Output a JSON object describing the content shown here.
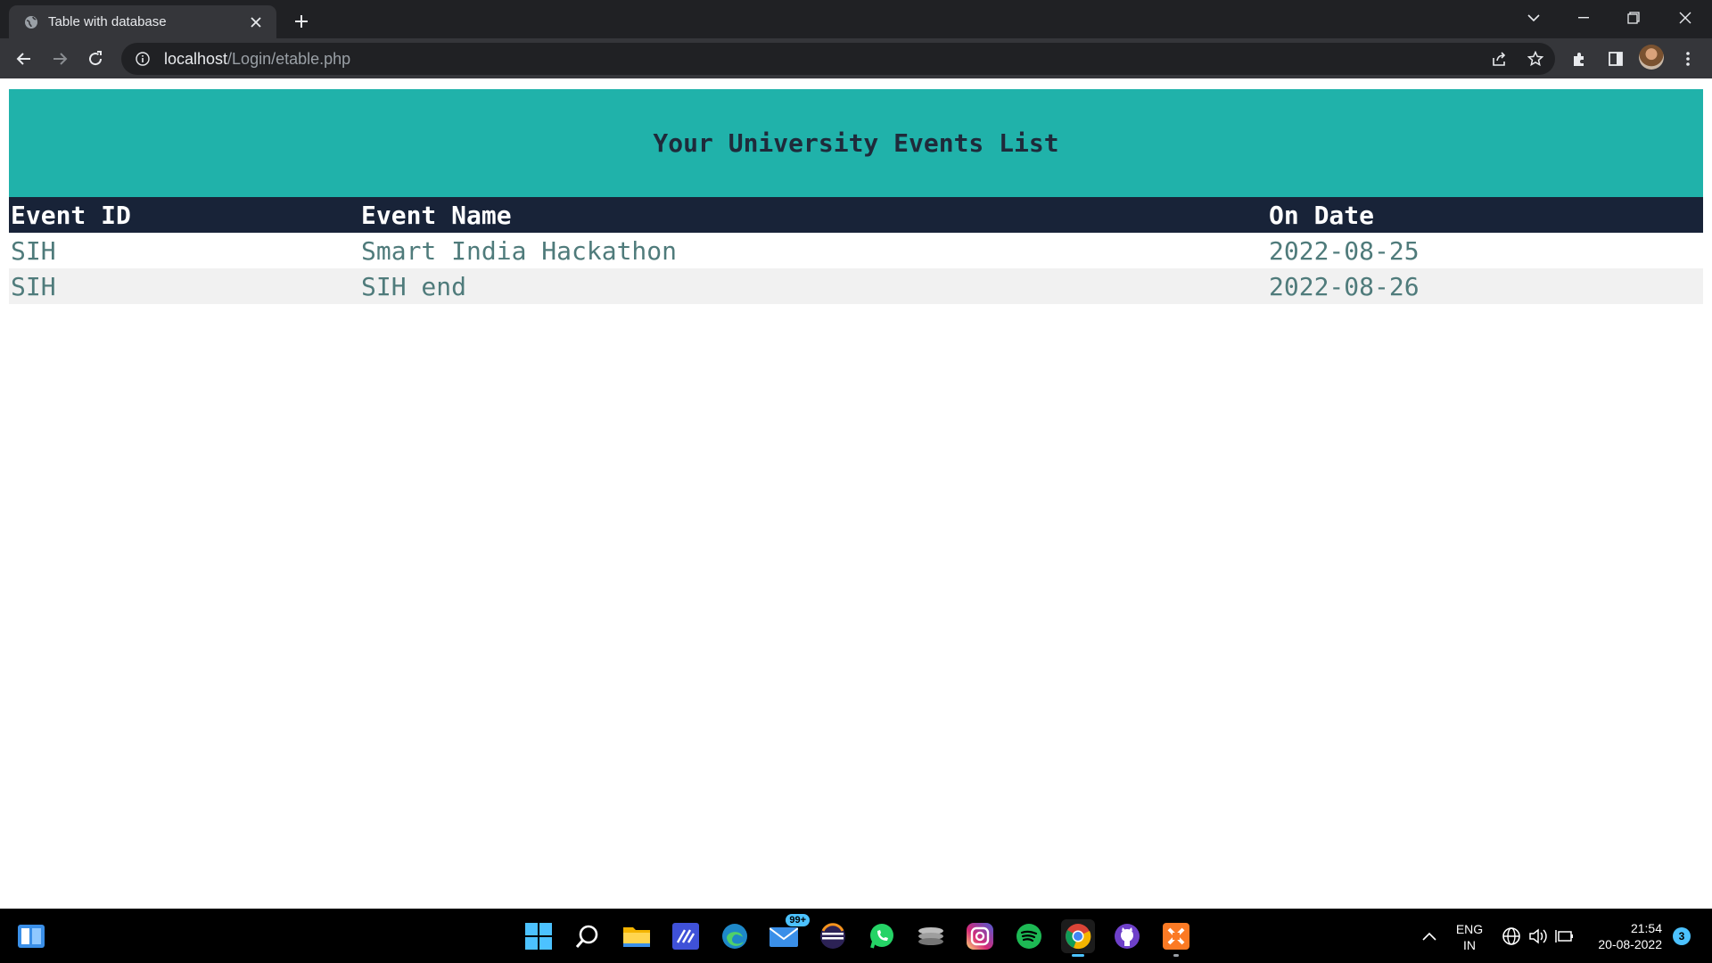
{
  "browser": {
    "tab_title": "Table with database",
    "url_host": "localhost",
    "url_path": "/Login/etable.php"
  },
  "page": {
    "heading": "Your University Events List",
    "table": {
      "headers": [
        "Event ID",
        "Event Name",
        "On Date"
      ],
      "rows": [
        [
          "SIH",
          "Smart India Hackathon",
          "2022-08-25"
        ],
        [
          "SIH",
          "SIH end",
          "2022-08-26"
        ]
      ]
    },
    "colors": {
      "banner": "#20b2aa",
      "header_bg": "#182338",
      "cell_text": "#4f7b7b",
      "alt_row": "#f1f1f1"
    }
  },
  "taskbar": {
    "mail_badge": "99+",
    "language_line1": "ENG",
    "language_line2": "IN",
    "time": "21:54",
    "date": "20-08-2022",
    "notification_count": "3",
    "pinned_apps": [
      "windows-start-icon",
      "search-icon",
      "file-explorer-icon",
      "code-editor-icon",
      "edge-icon",
      "mail-icon",
      "eclipse-icon",
      "whatsapp-icon",
      "disk-app-icon",
      "instagram-icon",
      "spotify-icon",
      "chrome-icon",
      "github-icon",
      "xampp-icon"
    ]
  }
}
